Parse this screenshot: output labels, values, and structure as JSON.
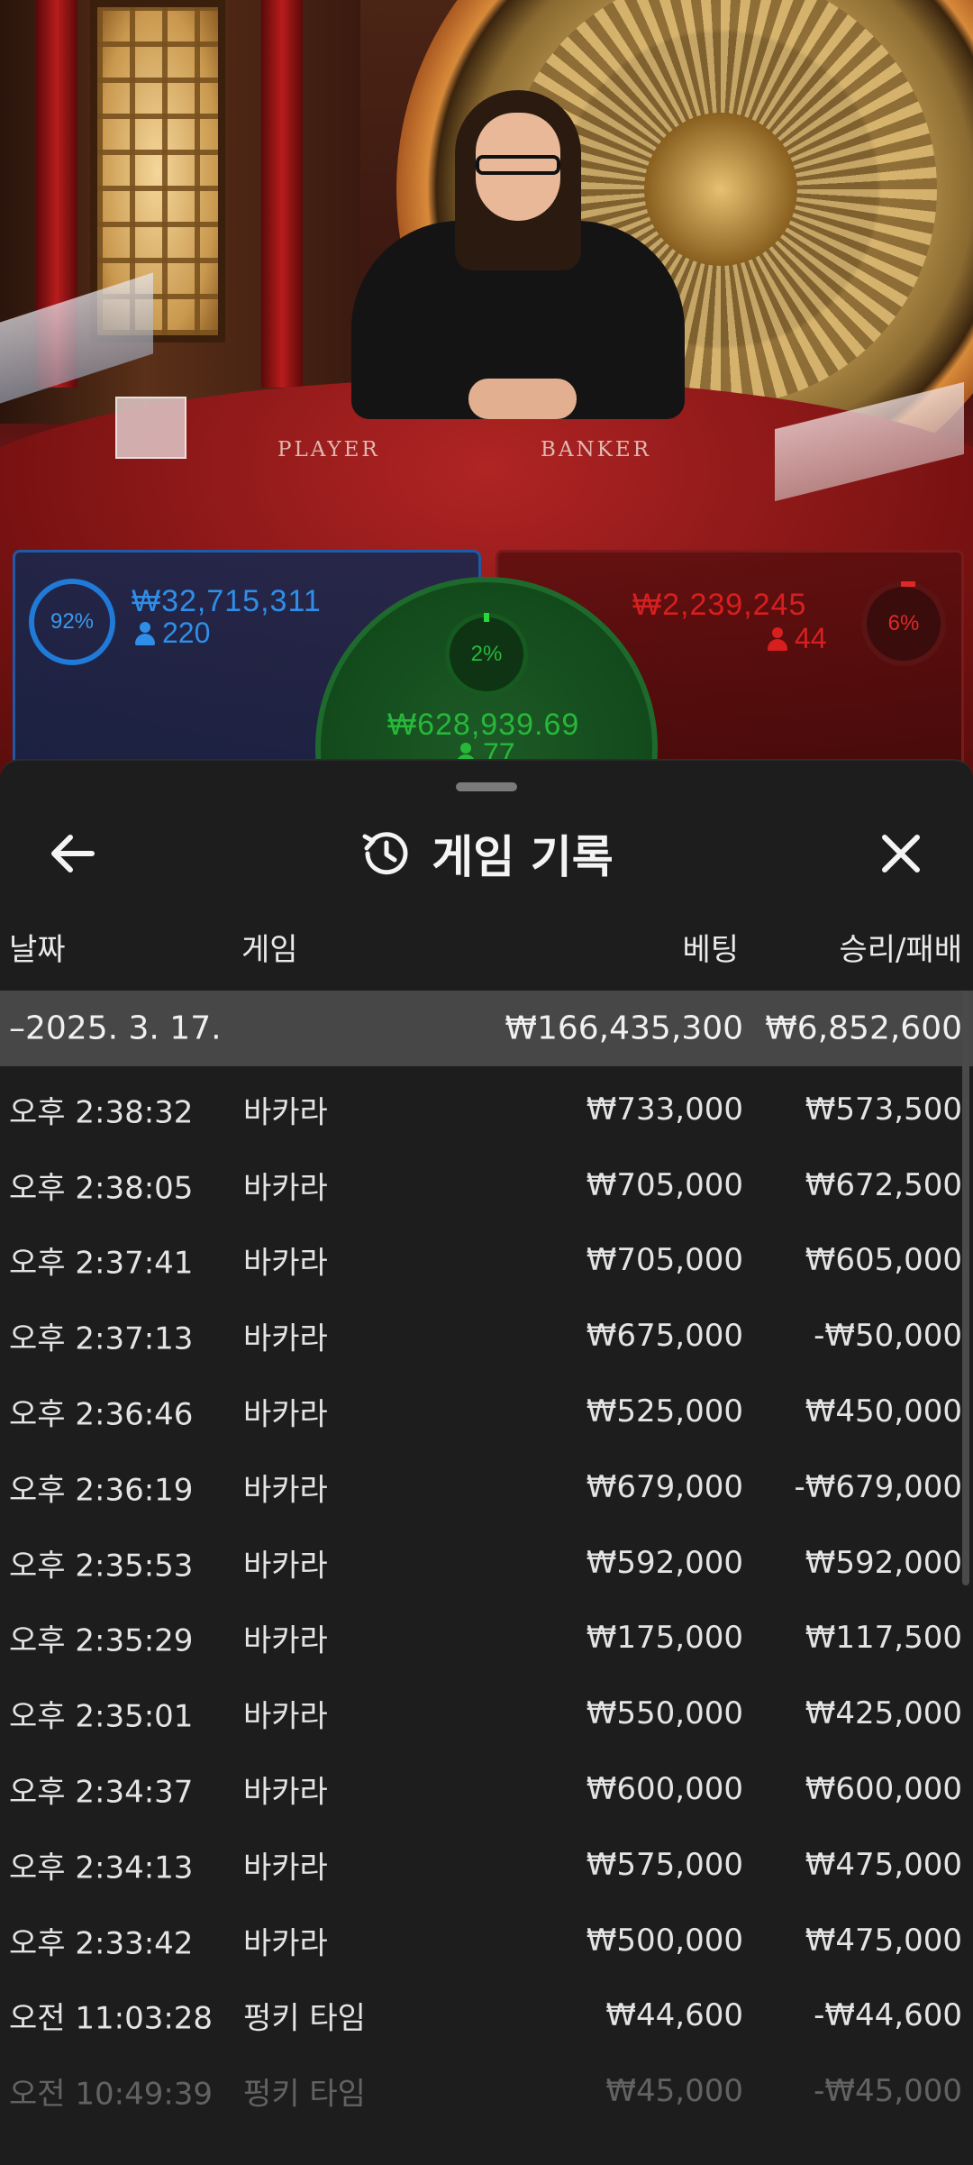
{
  "video": {
    "table_labels": {
      "player": "PLAYER",
      "banker": "BANKER"
    }
  },
  "bets": {
    "player": {
      "percent": "92%",
      "amount": "₩32,715,311",
      "players": "220",
      "color": "#1f7ad8"
    },
    "tie": {
      "percent": "2%",
      "amount": "₩628,939.69",
      "players": "77",
      "color": "#27b83a"
    },
    "banker": {
      "percent": "6%",
      "amount": "₩2,239,245",
      "players": "44",
      "color": "#e02828"
    }
  },
  "history": {
    "title": "게임 기록",
    "columns": {
      "date": "날짜",
      "game": "게임",
      "bet": "베팅",
      "winloss": "승리/패배"
    },
    "day": {
      "label": "–2025. 3. 17.",
      "bet_total": "₩166,435,300",
      "winloss_total": "₩6,852,600"
    },
    "rows": [
      {
        "time": "오후 2:38:32",
        "game": "바카라",
        "bet": "₩733,000",
        "winloss": "₩573,500"
      },
      {
        "time": "오후 2:38:05",
        "game": "바카라",
        "bet": "₩705,000",
        "winloss": "₩672,500"
      },
      {
        "time": "오후 2:37:41",
        "game": "바카라",
        "bet": "₩705,000",
        "winloss": "₩605,000"
      },
      {
        "time": "오후 2:37:13",
        "game": "바카라",
        "bet": "₩675,000",
        "winloss": "-₩50,000"
      },
      {
        "time": "오후 2:36:46",
        "game": "바카라",
        "bet": "₩525,000",
        "winloss": "₩450,000"
      },
      {
        "time": "오후 2:36:19",
        "game": "바카라",
        "bet": "₩679,000",
        "winloss": "-₩679,000"
      },
      {
        "time": "오후 2:35:53",
        "game": "바카라",
        "bet": "₩592,000",
        "winloss": "₩592,000"
      },
      {
        "time": "오후 2:35:29",
        "game": "바카라",
        "bet": "₩175,000",
        "winloss": "₩117,500"
      },
      {
        "time": "오후 2:35:01",
        "game": "바카라",
        "bet": "₩550,000",
        "winloss": "₩425,000"
      },
      {
        "time": "오후 2:34:37",
        "game": "바카라",
        "bet": "₩600,000",
        "winloss": "₩600,000"
      },
      {
        "time": "오후 2:34:13",
        "game": "바카라",
        "bet": "₩575,000",
        "winloss": "₩475,000"
      },
      {
        "time": "오후 2:33:42",
        "game": "바카라",
        "bet": "₩500,000",
        "winloss": "₩475,000"
      },
      {
        "time": "오전 11:03:28",
        "game": "펑키 타임",
        "bet": "₩44,600",
        "winloss": "-₩44,600"
      },
      {
        "time": "오전 10:49:39",
        "game": "펑키 타임",
        "bet": "₩45,000",
        "winloss": "-₩45,000"
      }
    ],
    "icons": {
      "back": "arrow-left-icon",
      "history": "history-clock-icon",
      "close": "close-icon"
    }
  }
}
